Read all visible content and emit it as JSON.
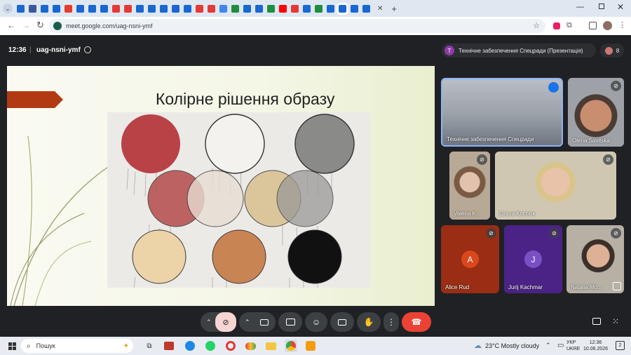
{
  "browser": {
    "tab_colors": [
      "#1967d2",
      "#3b5998",
      "#1967d2",
      "#1967d2",
      "#e43e2b",
      "#1967d2",
      "#1967d2",
      "#1967d2",
      "#e53935",
      "#e53935",
      "#1967d2",
      "#1967d2",
      "#1967d2",
      "#1967d2",
      "#1967d2",
      "#e53935",
      "#e53935",
      "#4285f4",
      "#1e8e3e",
      "#1967d2",
      "#1967d2",
      "#1e8e3e",
      "#ff0000",
      "#e53935",
      "#1967d2",
      "#1e8e3e",
      "#1967d2",
      "#1967d2",
      "#1967d2",
      "#1967d2"
    ],
    "url": "meet.google.com/uag-nsni-ymf"
  },
  "meet": {
    "time": "12:36",
    "meeting_code": "uag-nsni-ymf",
    "presenter_chip_initial": "T",
    "presenter_chip_label": "Технічне забезпечення Спецради (Презентація)",
    "participant_count": "8",
    "slide_title": "Колірне рішення образу",
    "participants": [
      {
        "name": "Технічне забезпечення Спецради"
      },
      {
        "name": "Olena Savitska"
      },
      {
        "name": "Valeria K..."
      },
      {
        "name": "Ольга Клєтюк"
      },
      {
        "name": "Alice Rud",
        "initial": "A",
        "color": "#b03a1e"
      },
      {
        "name": "Jurij Kachmar",
        "initial": "J",
        "color": "#5a2d9e"
      },
      {
        "name": "Natalia Mo..."
      }
    ]
  },
  "controls": {
    "end_call_color": "#ea4335",
    "mic_off_color": "#f6d5d2"
  },
  "taskbar": {
    "search_label": "Пошук",
    "weather": "23°C  Mostly cloudy",
    "lang_top": "УКР",
    "lang_bottom": "UKRE",
    "clock_time": "12:36",
    "clock_date": "10.06.2026",
    "notif_count": "2"
  }
}
